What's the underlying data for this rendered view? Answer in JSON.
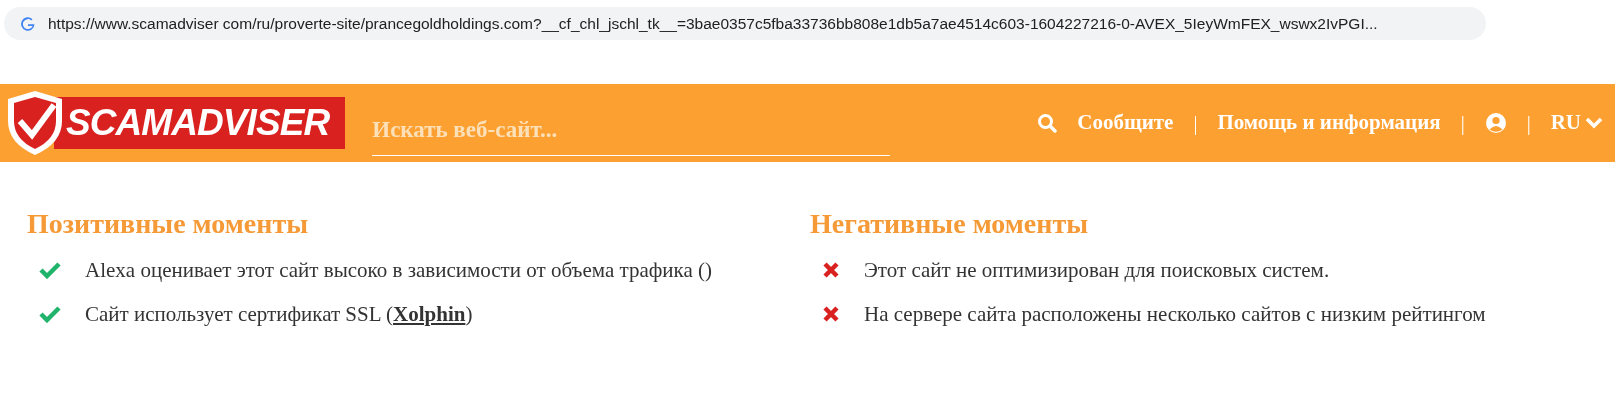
{
  "address_bar": {
    "url": "https://www.scamadviser com/ru/proverte-site/prancegoldholdings.com?__cf_chl_jschl_tk__=3bae0357c5fba33736bb808e1db5a7ae4514c603-1604227216-0-AVEX_5IeyWmFEX_wswx2IvPGI..."
  },
  "header": {
    "logo": "SCAMADVISER",
    "search": {
      "placeholder": "Искать веб-сайт..."
    },
    "nav": [
      {
        "kind": "search"
      },
      {
        "kind": "link",
        "label": "Сообщите"
      },
      {
        "kind": "separator",
        "label": "|"
      },
      {
        "kind": "link",
        "label": "Помощь и информация"
      },
      {
        "kind": "separator",
        "label": "|"
      },
      {
        "kind": "account"
      },
      {
        "kind": "separator",
        "label": "|"
      },
      {
        "kind": "language",
        "label": "RU"
      }
    ]
  },
  "sections": [
    {
      "title": "Позитивные моменты",
      "items": [
        {
          "kind": "positive",
          "text": "Alexa оценивает этот сайт высоко в зависимости от объема трафика ()"
        },
        {
          "kind": "positive",
          "text": "Сайт использует сертификат SSL (",
          "link": "Xolphin",
          "text_after": ")"
        }
      ]
    },
    {
      "title": "Негативные моменты",
      "items": [
        {
          "kind": "negative",
          "text": "Этот сайт не оптимизирован для поисковых систем."
        },
        {
          "kind": "negative",
          "text": "На сервере сайта расположены несколько сайтов с низким рейтингом"
        }
      ]
    }
  ]
}
